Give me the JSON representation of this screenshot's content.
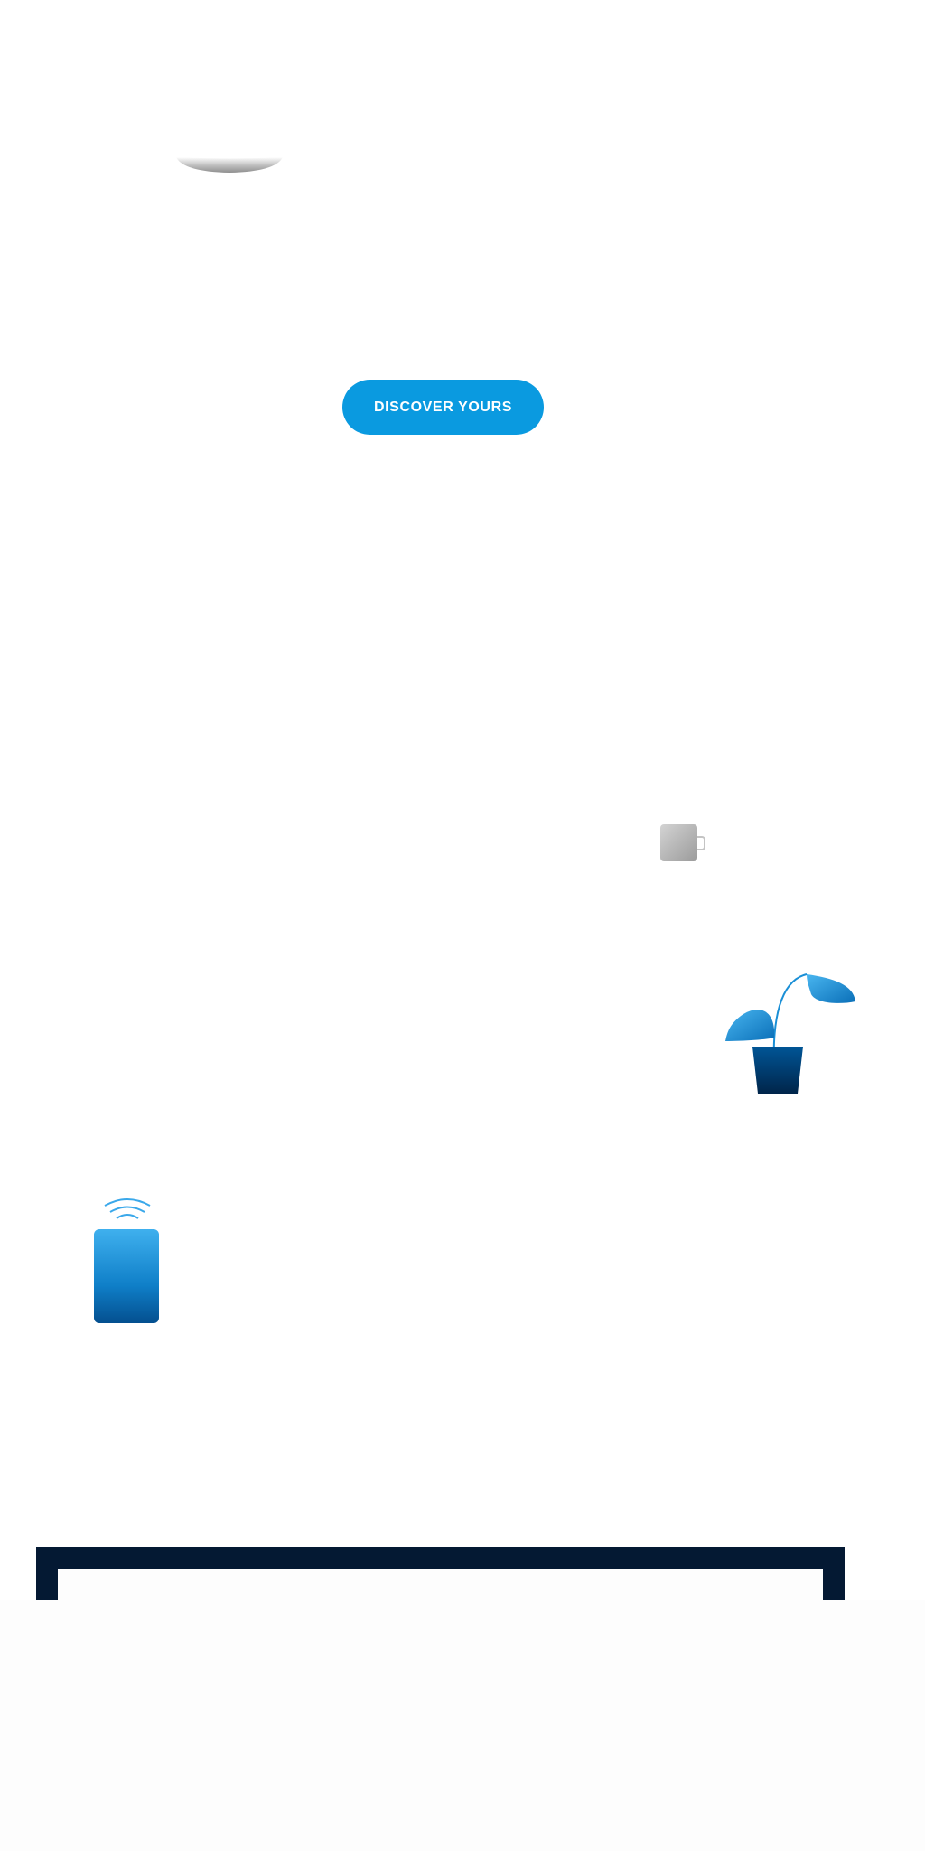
{
  "hero": {
    "cta_label": "DISCOVER YOURS"
  },
  "illustrations": {
    "top": "bowl-icon",
    "mug": "mug-icon",
    "plant": "plant-icon",
    "speaker": "speaker-icon"
  },
  "colors": {
    "accent": "#0a9ae0",
    "navy": "#041933",
    "dark_blue": "#003e7a",
    "light_blue": "#2aa5e8",
    "gray": "#a9a9a9",
    "background": "#ffffff"
  }
}
